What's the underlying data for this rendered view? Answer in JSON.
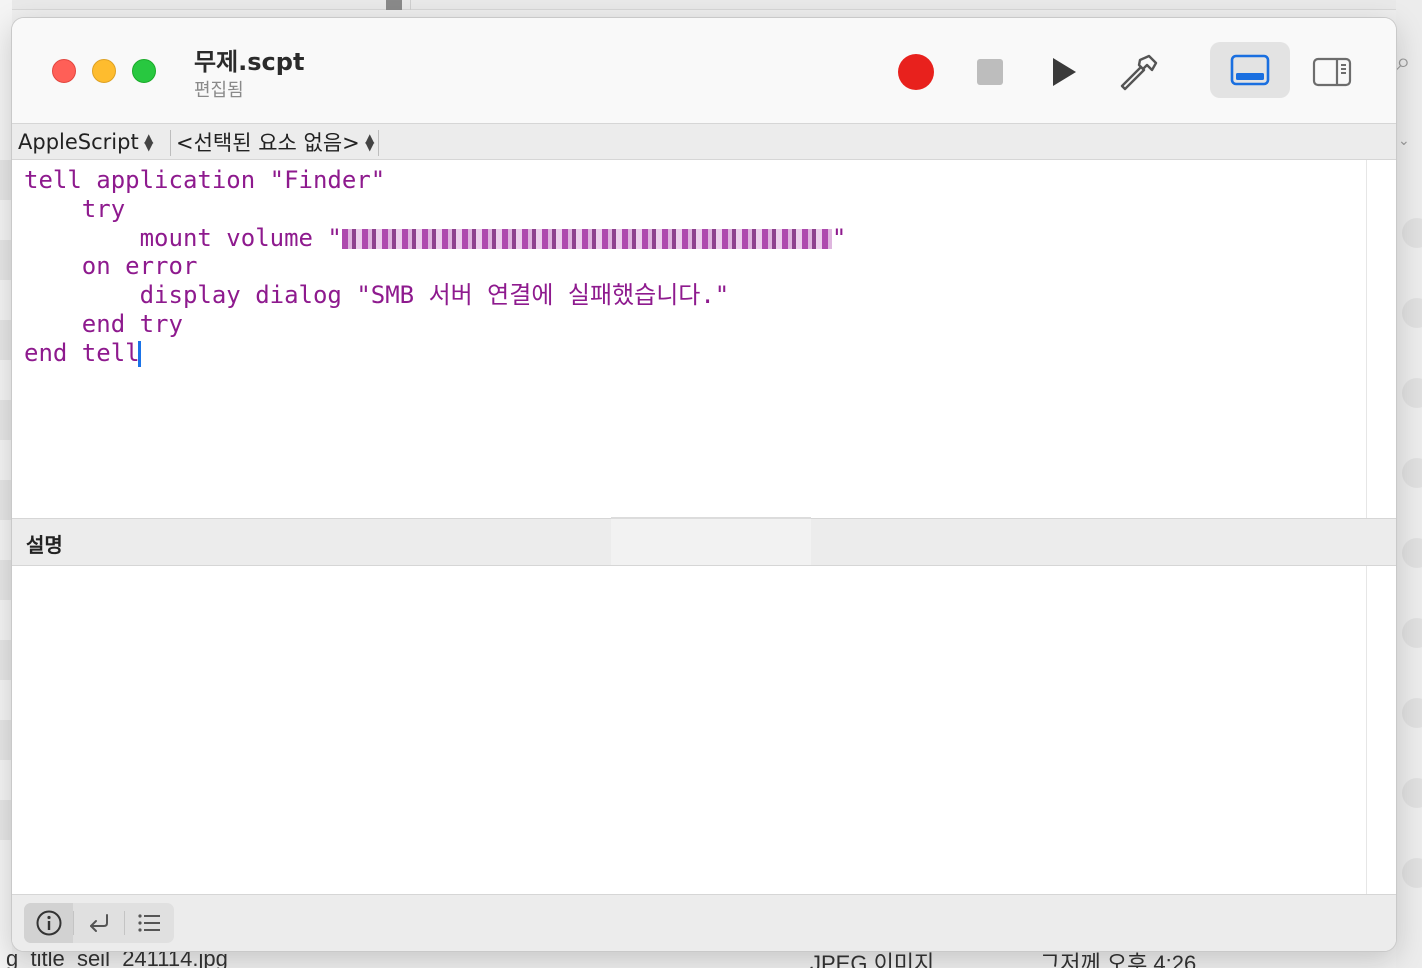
{
  "window": {
    "title": "무제.scpt",
    "subtitle": "편집됨"
  },
  "toolbar": {
    "record_icon": "record-icon",
    "stop_icon": "stop-icon",
    "run_icon": "play-icon",
    "compile_icon": "hammer-icon",
    "log_view_icon": "bottom-panel-icon",
    "side_view_icon": "sidebar-icon"
  },
  "navigation": {
    "language": "AppleScript",
    "element": "<선택된 요소 없음>"
  },
  "editor": {
    "lines": [
      {
        "indent": "",
        "text": "tell application \"Finder\""
      },
      {
        "indent": "    ",
        "text": "try"
      },
      {
        "indent": "        ",
        "text": "mount volume \"",
        "redacted": true,
        "after": "\""
      },
      {
        "indent": "    ",
        "text": "on error"
      },
      {
        "indent": "        ",
        "text": "display dialog \"SMB 서버 연결에 실패했습니다.\""
      },
      {
        "indent": "    ",
        "text": "end try"
      },
      {
        "indent": "",
        "text": "end tell",
        "caret": true
      }
    ]
  },
  "description_panel": {
    "label": "설명"
  },
  "bottom_bar": {
    "info_icon": "info-icon",
    "reply_icon": "return-arrow-icon",
    "list_icon": "list-icon"
  },
  "background": {
    "bottom_texts": [
      "g_title_seil_241114.jpg",
      "JPEG 이미지",
      "그저께 오후 4:26"
    ]
  },
  "colors": {
    "code": "#8e1a8e",
    "record": "#e8211d",
    "accent": "#1a73e8",
    "close": "#ff5f57",
    "minimize": "#febc2e",
    "zoom": "#28c840"
  }
}
